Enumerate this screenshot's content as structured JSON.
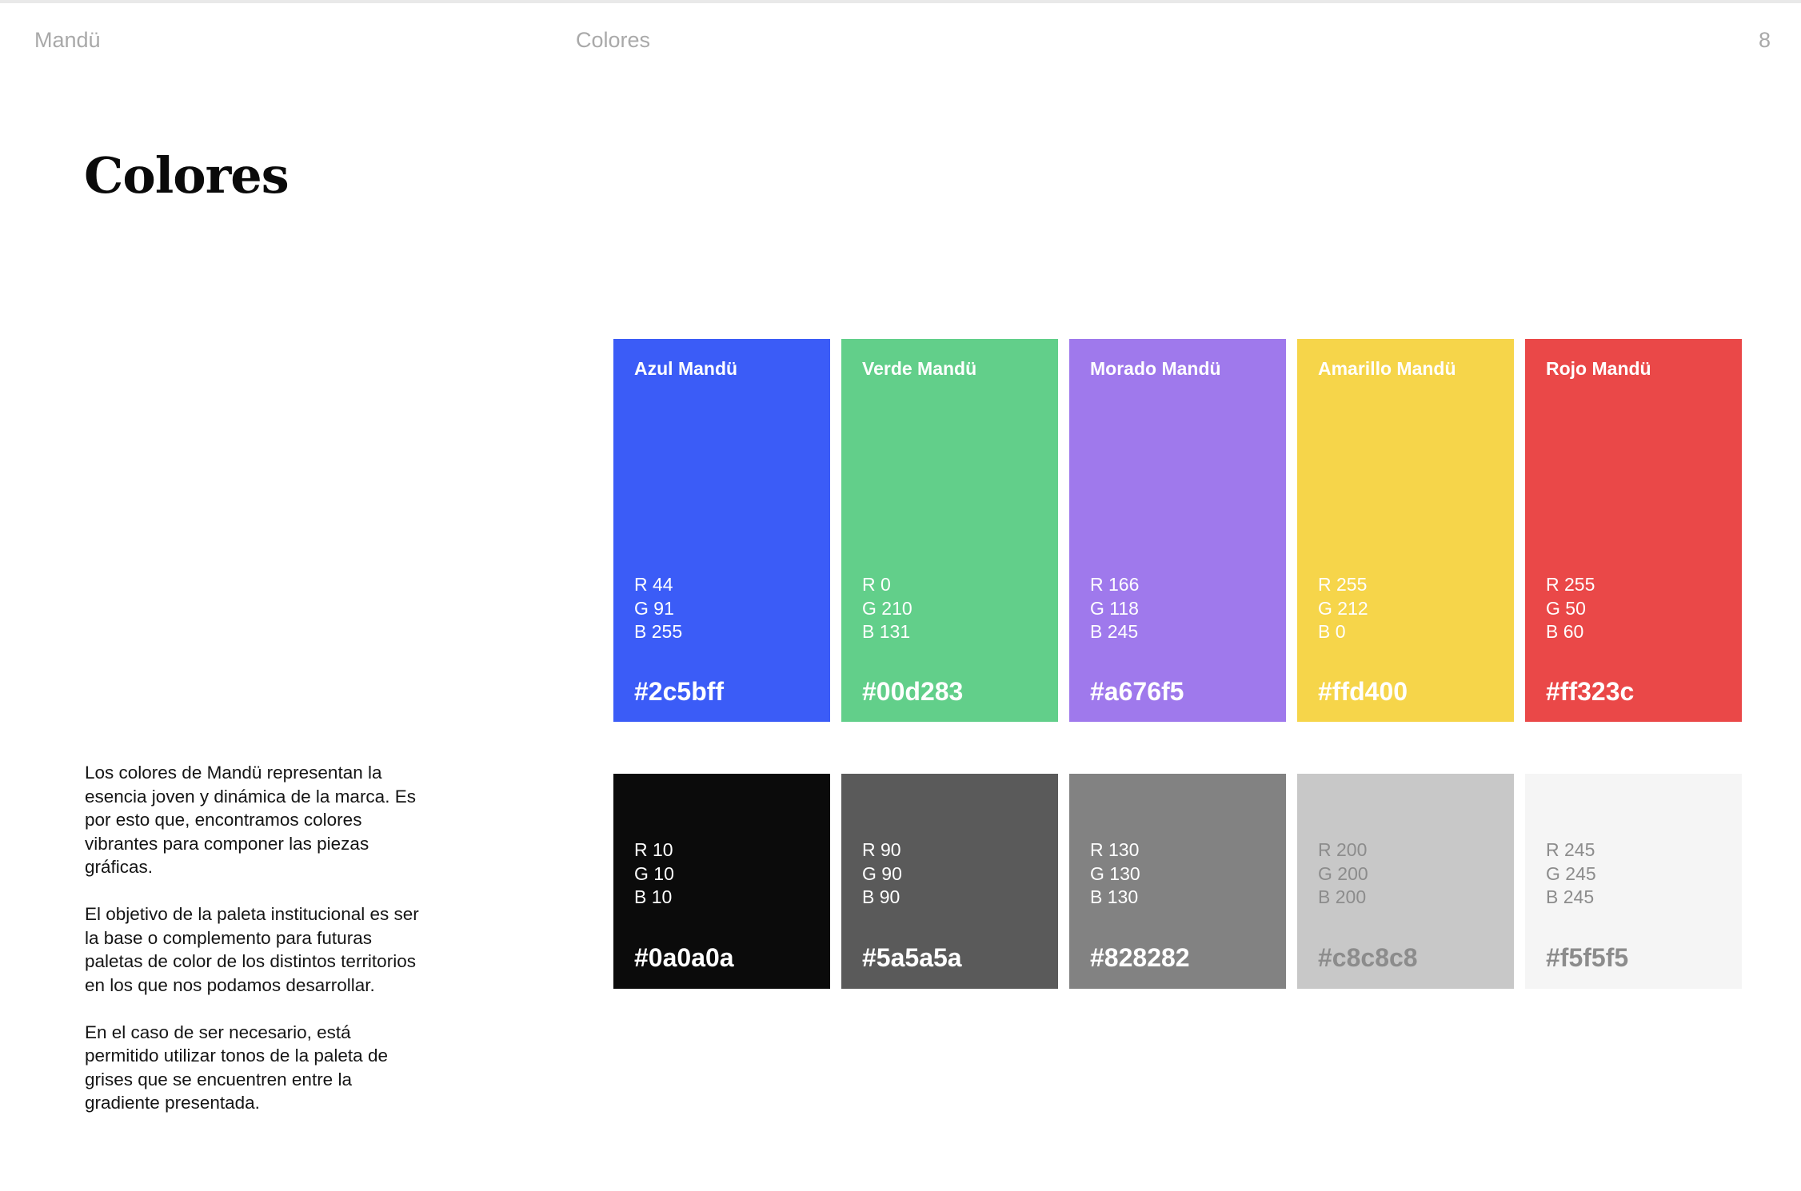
{
  "header": {
    "brand": "Mandü",
    "section": "Colores",
    "page_number": "8"
  },
  "title": "Colores",
  "description": [
    "Los colores de Mandü representan la esencia joven y dinámica de la marca. Es por esto que, encontramos colores vibrantes para componer las piezas gráficas.",
    "El objetivo de la paleta institucional es ser la base o complemento para futuras paletas de color de los distintos territorios en los que nos podamos desarrollar.",
    "En el caso de ser necesario, está permitido utilizar tonos de la paleta de grises que se encuentren entre la gradiente presentada."
  ],
  "primary_palette": [
    {
      "name": "Azul Mandü",
      "r": "R 44",
      "g": "G 91",
      "b": "B 255",
      "hex": "#2c5bff",
      "swatch_color": "#3b5cf7",
      "text_color": "#ffffff"
    },
    {
      "name": "Verde Mandü",
      "r": "R 0",
      "g": "G 210",
      "b": "B 131",
      "hex": "#00d283",
      "swatch_color": "#62cf8a",
      "text_color": "#ffffff"
    },
    {
      "name": "Morado Mandü",
      "r": "R 166",
      "g": "G 118",
      "b": "B 245",
      "hex": "#a676f5",
      "swatch_color": "#9f79ec",
      "text_color": "#ffffff"
    },
    {
      "name": "Amarillo Mandü",
      "r": "R 255",
      "g": "G 212",
      "b": "B 0",
      "hex": "#ffd400",
      "swatch_color": "#f6d54a",
      "text_color": "#ffffff"
    },
    {
      "name": "Rojo Mandü",
      "r": "R 255",
      "g": "G 50",
      "b": "B 60",
      "hex": "#ff323c",
      "swatch_color": "#ea4848",
      "text_color": "#ffffff"
    }
  ],
  "grey_palette": [
    {
      "r": "R 10",
      "g": "G 10",
      "b": "B 10",
      "hex": "#0a0a0a",
      "swatch_color": "#0b0b0b",
      "text_color": "#ffffff"
    },
    {
      "r": "R 90",
      "g": "G 90",
      "b": "B 90",
      "hex": "#5a5a5a",
      "swatch_color": "#5a5a5a",
      "text_color": "#ffffff"
    },
    {
      "r": "R 130",
      "g": "G 130",
      "b": "B 130",
      "hex": "#828282",
      "swatch_color": "#828282",
      "text_color": "#ffffff"
    },
    {
      "r": "R 200",
      "g": "G 200",
      "b": "B 200",
      "hex": "#c8c8c8",
      "swatch_color": "#c8c8c8",
      "text_color": "#8c8c8c"
    },
    {
      "r": "R 245",
      "g": "G 245",
      "b": "B 245",
      "hex": "#f5f5f5",
      "swatch_color": "#f5f5f5",
      "text_color": "#8c8c8c"
    }
  ]
}
